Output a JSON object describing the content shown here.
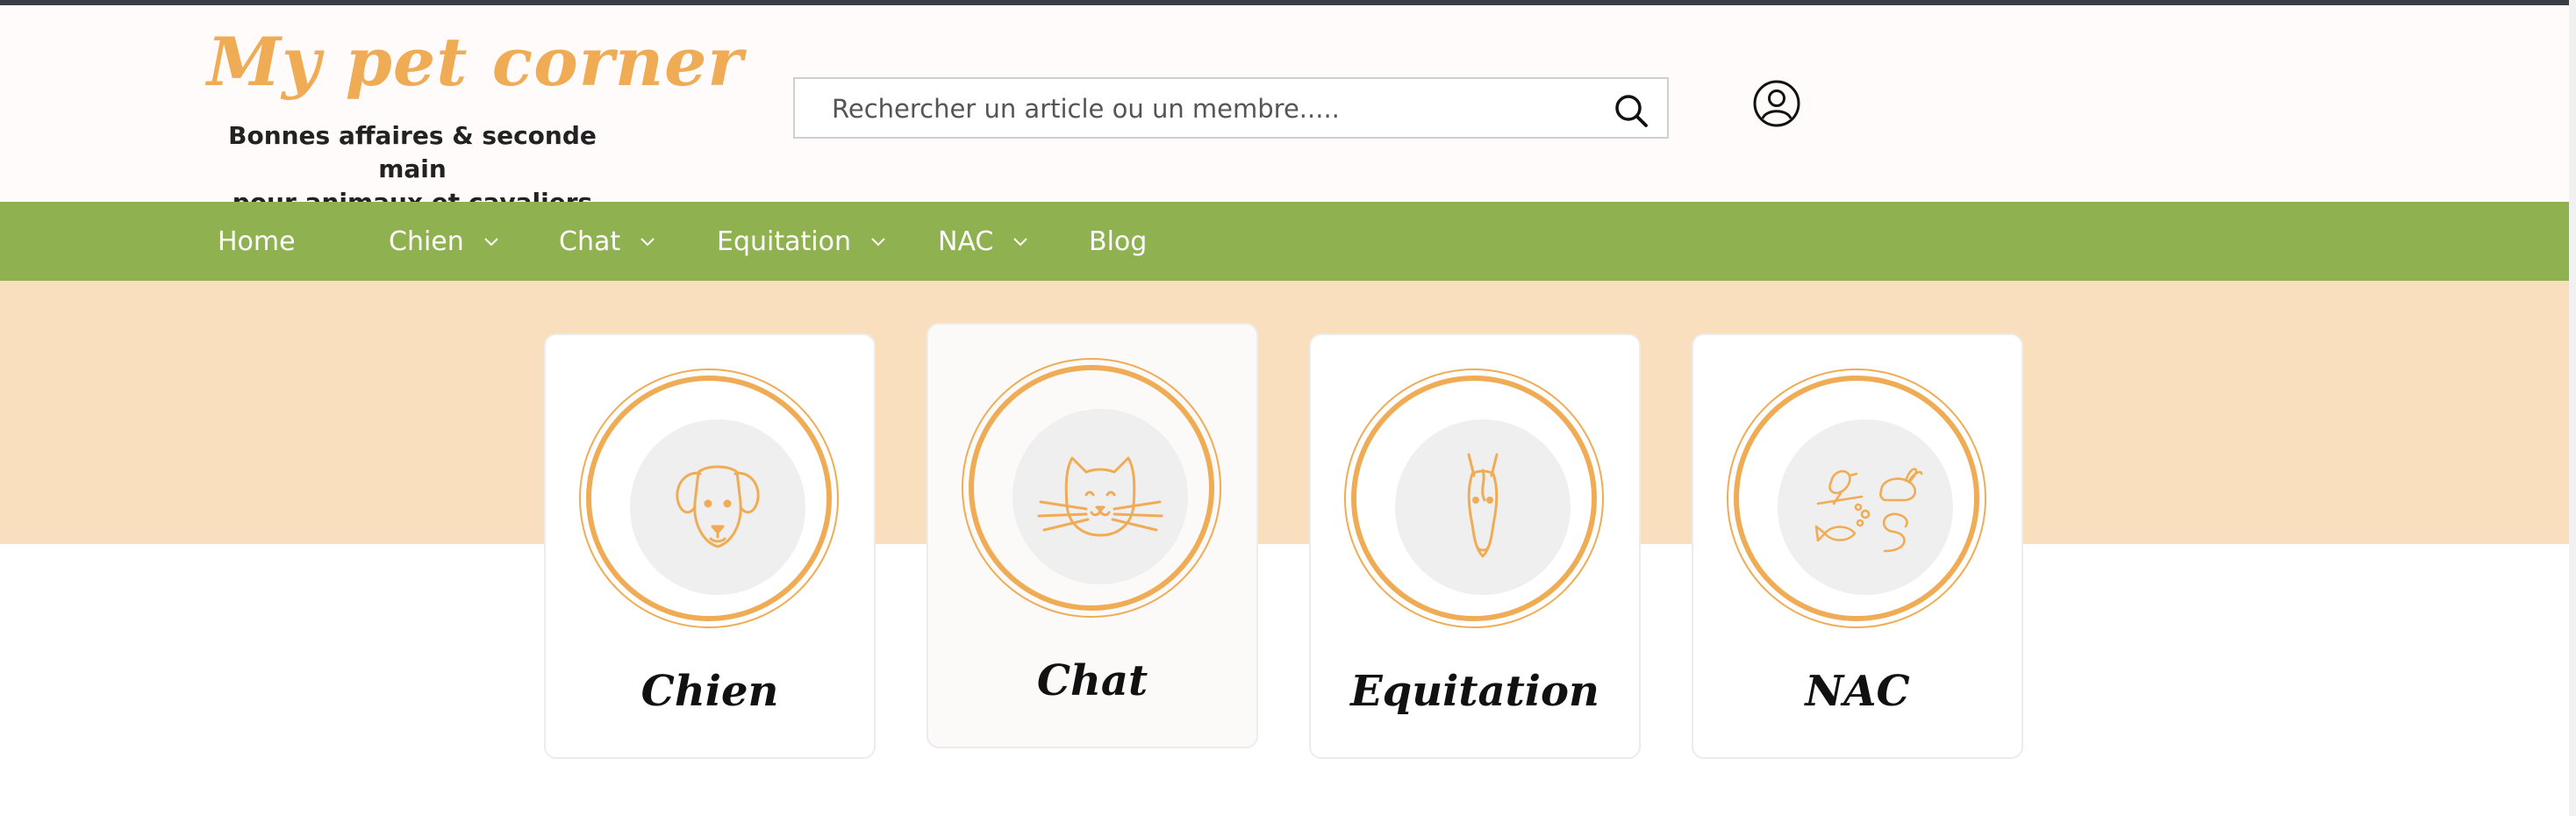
{
  "header": {
    "logo_title": "My pet corner",
    "logo_subtitle_line1": "Bonnes affaires & seconde main",
    "logo_subtitle_line2": "pour animaux et cavaliers"
  },
  "search": {
    "placeholder": "Rechercher un article ou un membre.....",
    "value": ""
  },
  "nav": {
    "items": [
      {
        "label": "Home",
        "has_dropdown": false
      },
      {
        "label": "Chien",
        "has_dropdown": true
      },
      {
        "label": "Chat",
        "has_dropdown": true
      },
      {
        "label": "Equitation",
        "has_dropdown": true
      },
      {
        "label": "NAC",
        "has_dropdown": true
      },
      {
        "label": "Blog",
        "has_dropdown": false
      }
    ]
  },
  "categories": [
    {
      "label": "Chien",
      "icon": "dog-icon"
    },
    {
      "label": "Chat",
      "icon": "cat-icon"
    },
    {
      "label": "Equitation",
      "icon": "horse-icon"
    },
    {
      "label": "NAC",
      "icon": "small-pets-icon"
    }
  ],
  "colors": {
    "accent_orange": "#f0ac55",
    "nav_green": "#90b150",
    "hero_peach": "#f9dfbd",
    "icon_bg": "#efefef"
  }
}
